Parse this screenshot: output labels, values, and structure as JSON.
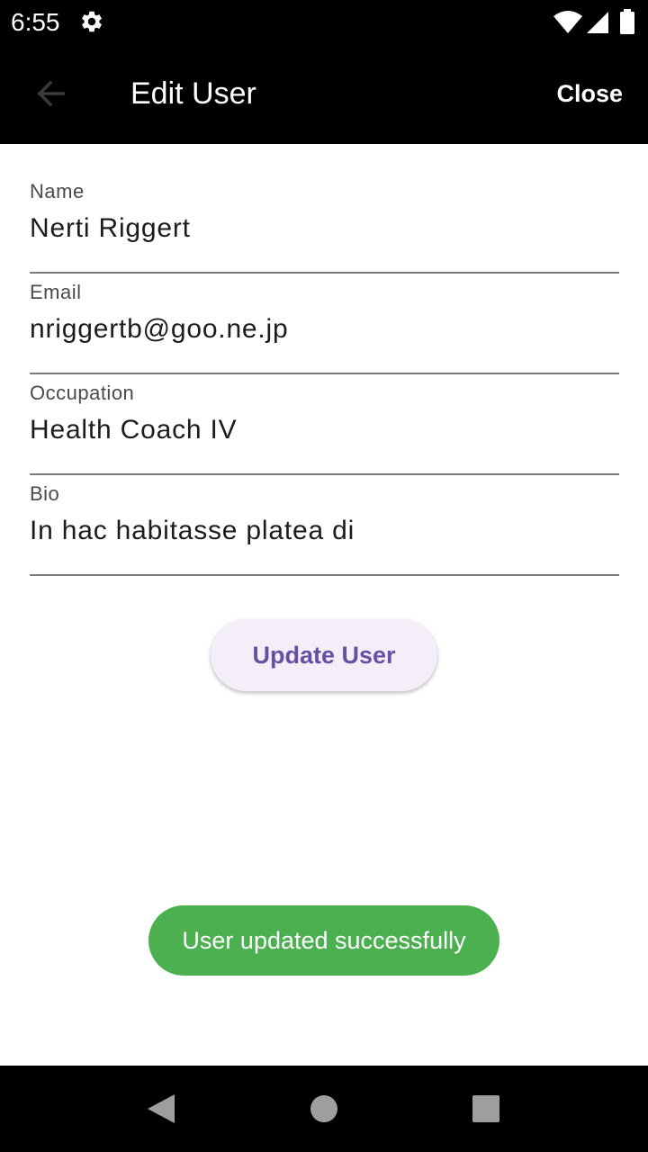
{
  "status_bar": {
    "time": "6:55",
    "icons": [
      "gear-icon",
      "wifi-icon",
      "signal-icon",
      "battery-icon"
    ]
  },
  "app_bar": {
    "title": "Edit User",
    "close_label": "Close",
    "back_icon": "arrow-back-icon"
  },
  "form": {
    "name": {
      "label": "Name",
      "value": "Nerti Riggert"
    },
    "email": {
      "label": "Email",
      "value": "nriggertb@goo.ne.jp"
    },
    "occupation": {
      "label": "Occupation",
      "value": "Health Coach IV"
    },
    "bio": {
      "label": "Bio",
      "value": "In hac habitasse platea di"
    }
  },
  "update_button": {
    "label": "Update User"
  },
  "toast": {
    "message": "User updated successfully"
  },
  "nav_bar": {
    "icons": [
      "nav-back-icon",
      "nav-home-icon",
      "nav-recents-icon"
    ]
  },
  "colors": {
    "bar_background": "#000000",
    "accent": "#6750a4",
    "button_background": "#f4eef8",
    "toast_background": "#4caf50",
    "underline": "#7a7a7a"
  }
}
